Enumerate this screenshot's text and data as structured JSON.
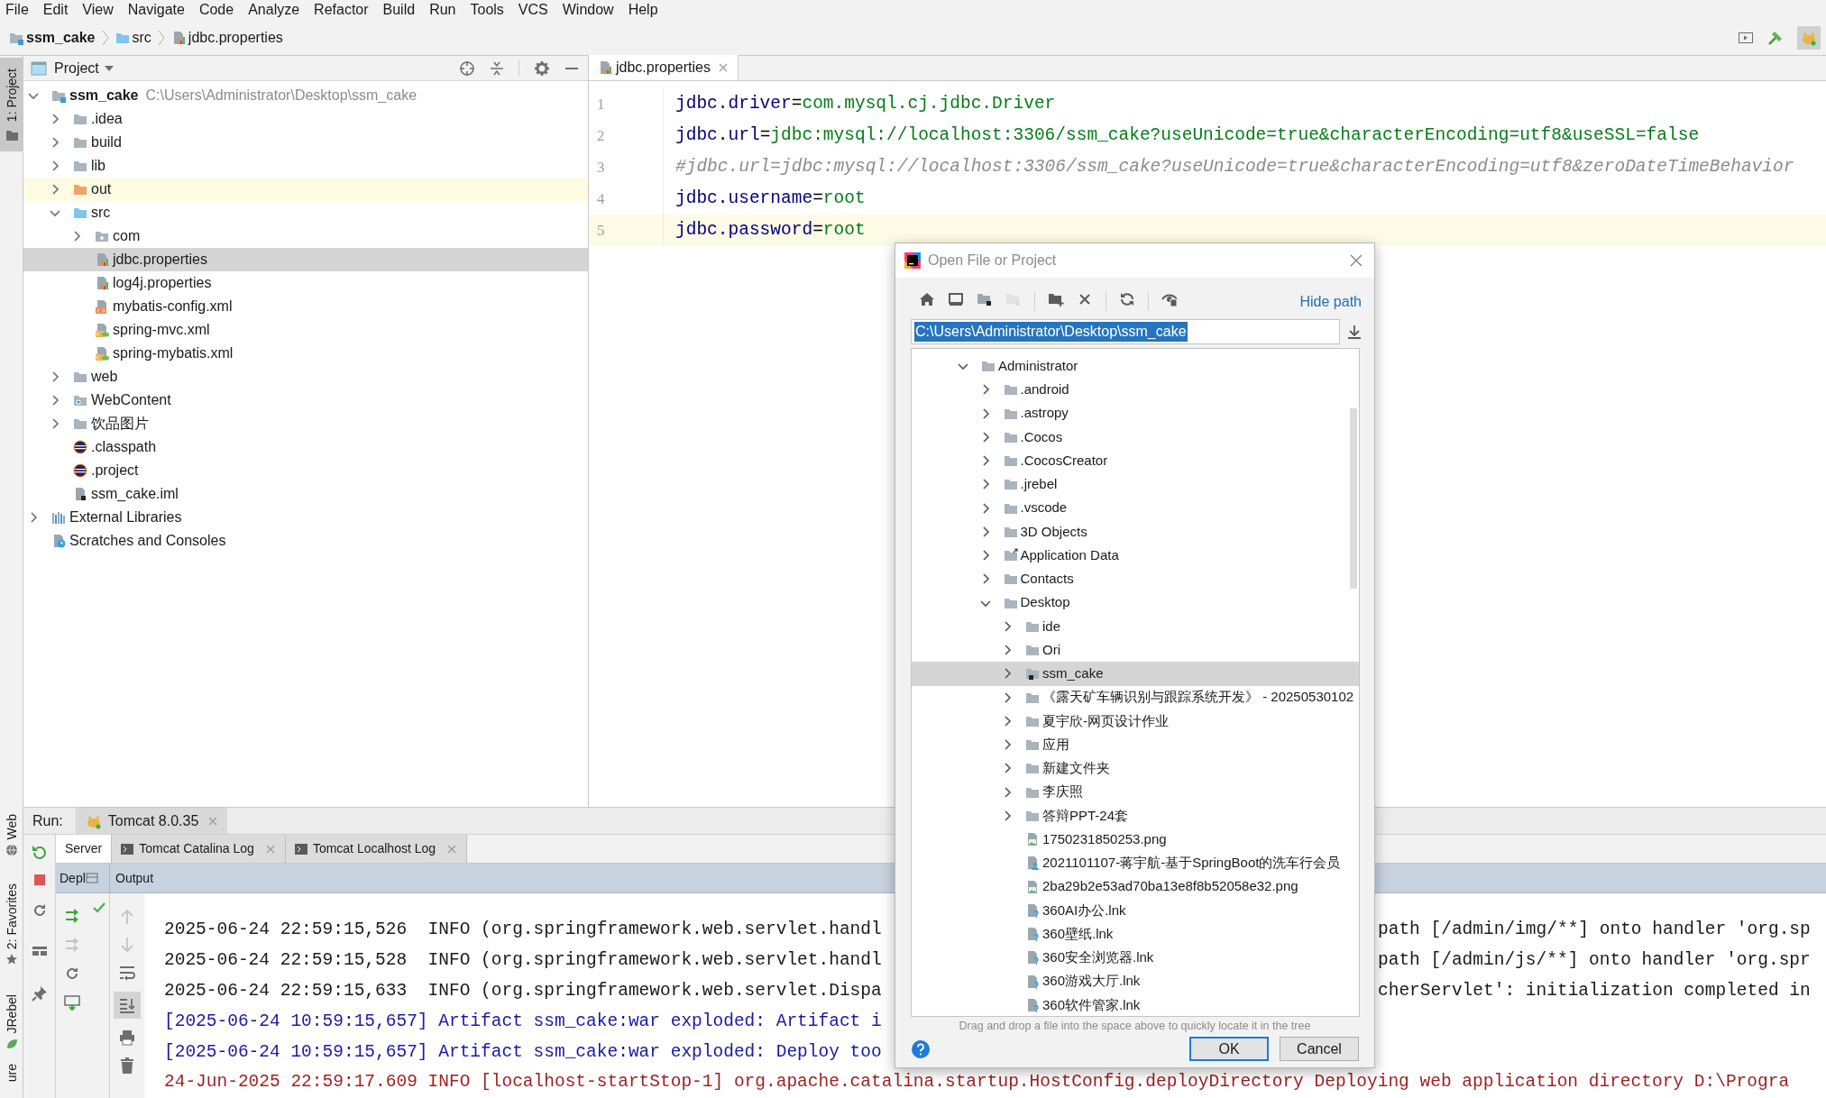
{
  "menu_bar": [
    "File",
    "Edit",
    "View",
    "Navigate",
    "Code",
    "Analyze",
    "Refactor",
    "Build",
    "Run",
    "Tools",
    "VCS",
    "Window",
    "Help"
  ],
  "breadcrumbs": [
    {
      "label": "ssm_cake",
      "kind": "project"
    },
    {
      "label": "src",
      "kind": "source_folder"
    },
    {
      "label": "jdbc.properties",
      "kind": "properties"
    }
  ],
  "side_strip": {
    "top": [
      {
        "label": "1: Project",
        "selected": true
      }
    ],
    "bottom": [
      {
        "label": "Web",
        "kind": "web",
        "selected": false
      },
      {
        "label": "2: Favorites",
        "kind": "favorites",
        "selected": false
      },
      {
        "label": "JRebel",
        "kind": "jrebel",
        "selected": false
      },
      {
        "label": "ure",
        "kind": "structure",
        "selected": false
      }
    ]
  },
  "project_panel": {
    "title": "Project",
    "tree": [
      {
        "label": "ssm_cake",
        "path": "C:\\Users\\Administrator\\Desktop\\ssm_cake",
        "kind": "project",
        "expanded": true,
        "selected": false,
        "children": [
          {
            "label": ".idea",
            "kind": "folder",
            "expanded": false,
            "selected": false
          },
          {
            "label": "build",
            "kind": "folder",
            "expanded": false,
            "selected": false
          },
          {
            "label": "lib",
            "kind": "folder",
            "expanded": false,
            "selected": false
          },
          {
            "label": "out",
            "kind": "excluded_folder",
            "expanded": false,
            "selected": false
          },
          {
            "label": "src",
            "kind": "source_folder",
            "expanded": true,
            "selected": false,
            "children": [
              {
                "label": "com",
                "kind": "package",
                "expanded": false,
                "selected": false
              },
              {
                "label": "jdbc.properties",
                "kind": "properties",
                "selected": true
              },
              {
                "label": "log4j.properties",
                "kind": "properties",
                "selected": false
              },
              {
                "label": "mybatis-config.xml",
                "kind": "xml",
                "selected": false
              },
              {
                "label": "spring-mvc.xml",
                "kind": "spring_xml",
                "selected": false
              },
              {
                "label": "spring-mybatis.xml",
                "kind": "spring_xml",
                "selected": false
              }
            ]
          },
          {
            "label": "web",
            "kind": "folder",
            "expanded": false,
            "selected": false
          },
          {
            "label": "WebContent",
            "kind": "web_folder",
            "expanded": false,
            "selected": false
          },
          {
            "label": "饮品图片",
            "kind": "folder",
            "expanded": false,
            "selected": false
          },
          {
            "label": ".classpath",
            "kind": "eclipse",
            "selected": false
          },
          {
            "label": ".project",
            "kind": "eclipse",
            "selected": false
          },
          {
            "label": "ssm_cake.iml",
            "kind": "iml",
            "selected": false
          }
        ]
      },
      {
        "label": "External Libraries",
        "kind": "libraries",
        "expanded": false,
        "selected": false
      },
      {
        "label": "Scratches and Consoles",
        "kind": "scratches",
        "selected": false
      }
    ]
  },
  "editor": {
    "tabs": [
      {
        "label": "jdbc.properties",
        "selected": true
      }
    ],
    "lines": [
      {
        "number": "1",
        "kind": "property",
        "key": "jdbc.driver",
        "separator": "=",
        "value": "com.mysql.cj.jdbc.Driver",
        "current": false
      },
      {
        "number": "2",
        "kind": "property",
        "key": "jdbc.url",
        "separator": "=",
        "value": "jdbc:mysql://localhost:3306/ssm_cake?useUnicode=true&characterEncoding=utf8&useSSL=false",
        "current": false
      },
      {
        "number": "3",
        "kind": "comment",
        "text": "#jdbc.url=jdbc:mysql://localhost:3306/ssm_cake?useUnicode=true&characterEncoding=utf8&zeroDateTimeBehavior",
        "current": false
      },
      {
        "number": "4",
        "kind": "property",
        "key": "jdbc.username",
        "separator": "=",
        "value": "root",
        "current": false
      },
      {
        "number": "5",
        "kind": "property",
        "key": "jdbc.password",
        "separator": "=",
        "value": "root",
        "current": true
      }
    ]
  },
  "run_panel": {
    "label": "Run:",
    "tabs": [
      {
        "label": "Tomcat 8.0.35",
        "selected": true
      }
    ],
    "sub_tabs": [
      {
        "label": "Server",
        "kind": "plain",
        "selected": true
      },
      {
        "label": "Tomcat Catalina Log",
        "kind": "log",
        "selected": false
      },
      {
        "label": "Tomcat Localhost Log",
        "kind": "log",
        "selected": false
      }
    ],
    "columns": [
      "Depl",
      "Output"
    ],
    "console": [
      {
        "kind": "info",
        "left": "2025-06-24 22:59:15,526  INFO (org.springframework.web.servlet.handl",
        "right": "path [/admin/img/**] onto handler 'org.sp"
      },
      {
        "kind": "info",
        "left": "2025-06-24 22:59:15,528  INFO (org.springframework.web.servlet.handl",
        "right": "path [/admin/js/**] onto handler 'org.spr"
      },
      {
        "kind": "info",
        "left": "2025-06-24 22:59:15,633  INFO (org.springframework.web.servlet.Dispa",
        "right": "cherServlet': initialization completed in"
      },
      {
        "kind": "artifact",
        "left": "[2025-06-24 10:59:15,657] Artifact ssm_cake:war exploded: Artifact i"
      },
      {
        "kind": "artifact",
        "left": "[2025-06-24 10:59:15,657] Artifact ssm_cake:war exploded: Deploy too"
      },
      {
        "kind": "catalina",
        "left": "24-Jun-2025 22:59:17.609 INFO [localhost-startStop-1] org.apache.catalina.startup.HostConfig.deployDirectory Deploying web application directory D:\\Progra"
      }
    ]
  },
  "dialog": {
    "title": "Open File or Project",
    "toolbar": [
      {
        "kind": "home",
        "disabled": false
      },
      {
        "kind": "desktop",
        "disabled": false
      },
      {
        "kind": "project_folder",
        "disabled": false
      },
      {
        "kind": "module_folder",
        "disabled": true
      },
      {
        "kind": "new_folder",
        "disabled": false
      },
      {
        "kind": "delete",
        "disabled": false
      },
      {
        "kind": "refresh",
        "disabled": false
      },
      {
        "kind": "hidden_files",
        "disabled": false
      }
    ],
    "hide_path": "Hide path",
    "path": "C:\\Users\\Administrator\\Desktop\\ssm_cake",
    "tree": [
      {
        "label": "Administrator",
        "kind": "folder",
        "expanded": true,
        "selected": false,
        "children": [
          {
            "label": ".android",
            "kind": "folder",
            "expanded": false,
            "selected": false
          },
          {
            "label": ".astropy",
            "kind": "folder",
            "expanded": false,
            "selected": false
          },
          {
            "label": ".Cocos",
            "kind": "folder",
            "expanded": false,
            "selected": false
          },
          {
            "label": ".CocosCreator",
            "kind": "folder",
            "expanded": false,
            "selected": false
          },
          {
            "label": ".jrebel",
            "kind": "folder",
            "expanded": false,
            "selected": false
          },
          {
            "label": ".vscode",
            "kind": "folder",
            "expanded": false,
            "selected": false
          },
          {
            "label": "3D Objects",
            "kind": "folder",
            "expanded": false,
            "selected": false
          },
          {
            "label": "Application Data",
            "kind": "link_folder",
            "expanded": false,
            "selected": false
          },
          {
            "label": "Contacts",
            "kind": "folder",
            "expanded": false,
            "selected": false
          },
          {
            "label": "Desktop",
            "kind": "folder",
            "expanded": true,
            "selected": false,
            "children": [
              {
                "label": "ide",
                "kind": "folder",
                "expanded": false,
                "selected": false
              },
              {
                "label": "Ori",
                "kind": "folder",
                "expanded": false,
                "selected": false
              },
              {
                "label": "ssm_cake",
                "kind": "module_folder",
                "expanded": false,
                "selected": true
              },
              {
                "label": "《露天矿车辆识别与跟踪系统开发》 - 20250530102",
                "kind": "folder",
                "expanded": false,
                "selected": false
              },
              {
                "label": "夏宇欣-网页设计作业",
                "kind": "folder",
                "expanded": false,
                "selected": false
              },
              {
                "label": "应用",
                "kind": "folder",
                "expanded": false,
                "selected": false
              },
              {
                "label": "新建文件夹",
                "kind": "folder",
                "expanded": false,
                "selected": false
              },
              {
                "label": "李庆照",
                "kind": "folder",
                "expanded": false,
                "selected": false
              },
              {
                "label": "答辩PPT-24套",
                "kind": "folder",
                "expanded": false,
                "selected": false
              },
              {
                "label": "1750231850253.png",
                "kind": "image",
                "selected": false
              },
              {
                "label": "2021101107-蒋宇航-基于SpringBoot的洗车行会员",
                "kind": "document",
                "selected": false
              },
              {
                "label": "2ba29b2e53ad70ba13e8f8b52058e32.png",
                "kind": "image",
                "selected": false
              },
              {
                "label": "360AI办公.lnk",
                "kind": "shortcut",
                "selected": false
              },
              {
                "label": "360壁纸.lnk",
                "kind": "shortcut",
                "selected": false
              },
              {
                "label": "360安全浏览器.lnk",
                "kind": "shortcut",
                "selected": false
              },
              {
                "label": "360游戏大厅.lnk",
                "kind": "shortcut",
                "selected": false
              },
              {
                "label": "360软件管家.lnk",
                "kind": "shortcut",
                "selected": false
              }
            ]
          }
        ]
      }
    ],
    "hint": "Drag and drop a file into the space above to quickly locate it in the tree",
    "buttons": [
      {
        "label": "OK",
        "default": true
      },
      {
        "label": "Cancel",
        "default": false
      }
    ]
  }
}
